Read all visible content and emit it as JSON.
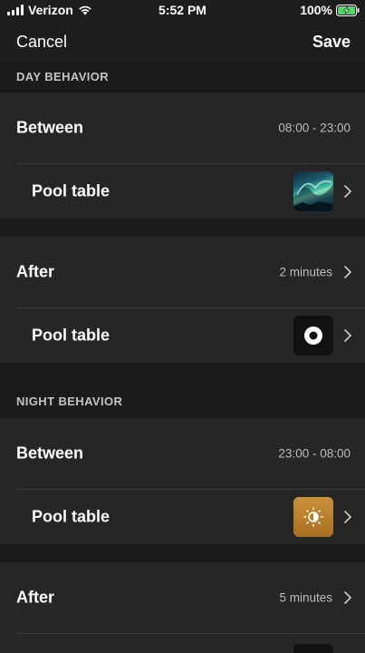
{
  "status_bar": {
    "carrier": "Verizon",
    "time": "5:52 PM",
    "battery_percent": "100%",
    "icons": [
      "signal-icon",
      "wifi-icon",
      "battery-charging-icon"
    ]
  },
  "nav": {
    "cancel_label": "Cancel",
    "save_label": "Save"
  },
  "day_behavior": {
    "header": "DAY BEHAVIOR",
    "between": {
      "label": "Between",
      "value": "08:00 - 23:00"
    },
    "between_room": {
      "label": "Pool table",
      "scene_icon": "aurora-scene-thumbnail"
    },
    "after": {
      "label": "After",
      "value": "2 minutes"
    },
    "after_room": {
      "label": "Pool table",
      "scene_icon": "light-off-icon"
    }
  },
  "night_behavior": {
    "header": "NIGHT BEHAVIOR",
    "between": {
      "label": "Between",
      "value": "23:00 - 08:00"
    },
    "between_room": {
      "label": "Pool table",
      "scene_icon": "dimmed-brightness-icon"
    },
    "after": {
      "label": "After",
      "value": "5 minutes"
    }
  },
  "colors": {
    "background": "#1b1b1b",
    "row_background": "#262626",
    "divider": "#3a3a3a",
    "secondary_text": "#bdbdbd",
    "gold_scene": "#c9913a",
    "battery_green": "#4cd964"
  }
}
